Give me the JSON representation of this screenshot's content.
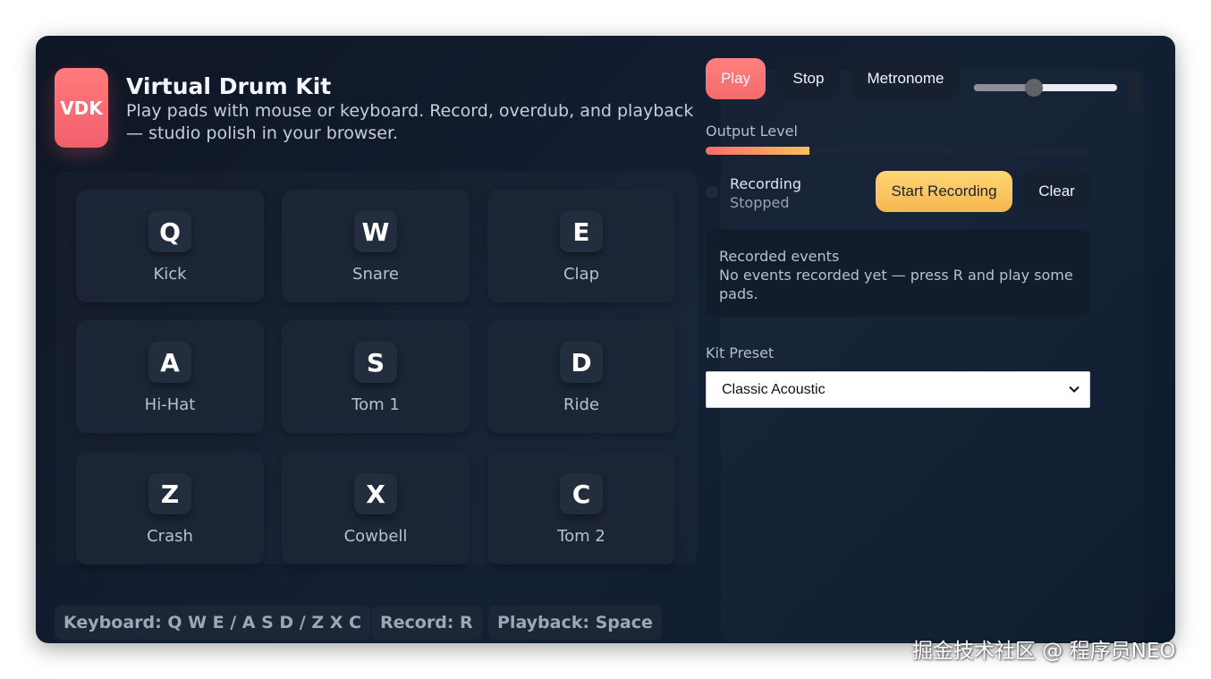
{
  "header": {
    "logo": "VDK",
    "title": "Virtual Drum Kit",
    "subtitle": "Play pads with mouse or keyboard. Record, overdub, and playback — studio polish in your browser."
  },
  "pads": [
    {
      "key": "Q",
      "name": "Kick"
    },
    {
      "key": "W",
      "name": "Snare"
    },
    {
      "key": "E",
      "name": "Clap"
    },
    {
      "key": "A",
      "name": "Hi-Hat"
    },
    {
      "key": "S",
      "name": "Tom 1"
    },
    {
      "key": "D",
      "name": "Ride"
    },
    {
      "key": "Z",
      "name": "Crash"
    },
    {
      "key": "X",
      "name": "Cowbell"
    },
    {
      "key": "C",
      "name": "Tom 2"
    }
  ],
  "hints": {
    "keyboard": "Keyboard: Q W E / A S D / Z X C",
    "record": "Record: R",
    "playback": "Playback: Space"
  },
  "controls": {
    "play_label": "Play",
    "stop_label": "Stop",
    "metronome_label": "Metronome",
    "volume_fraction": 0.42
  },
  "output": {
    "label": "Output Level",
    "level_fraction": 0.27
  },
  "recording": {
    "title": "Recording",
    "state": "Stopped",
    "start_label": "Start Recording",
    "clear_label": "Clear"
  },
  "events": {
    "title": "Recorded events",
    "empty_message": "No events recorded yet — press R and play some pads."
  },
  "preset": {
    "label": "Kit Preset",
    "selected": "Classic Acoustic"
  },
  "colors": {
    "accent_play": "#f36b6b",
    "accent_record": "#f5b74e",
    "background": "#142034"
  },
  "watermark": "掘金技术社区 @ 程序员NEO"
}
